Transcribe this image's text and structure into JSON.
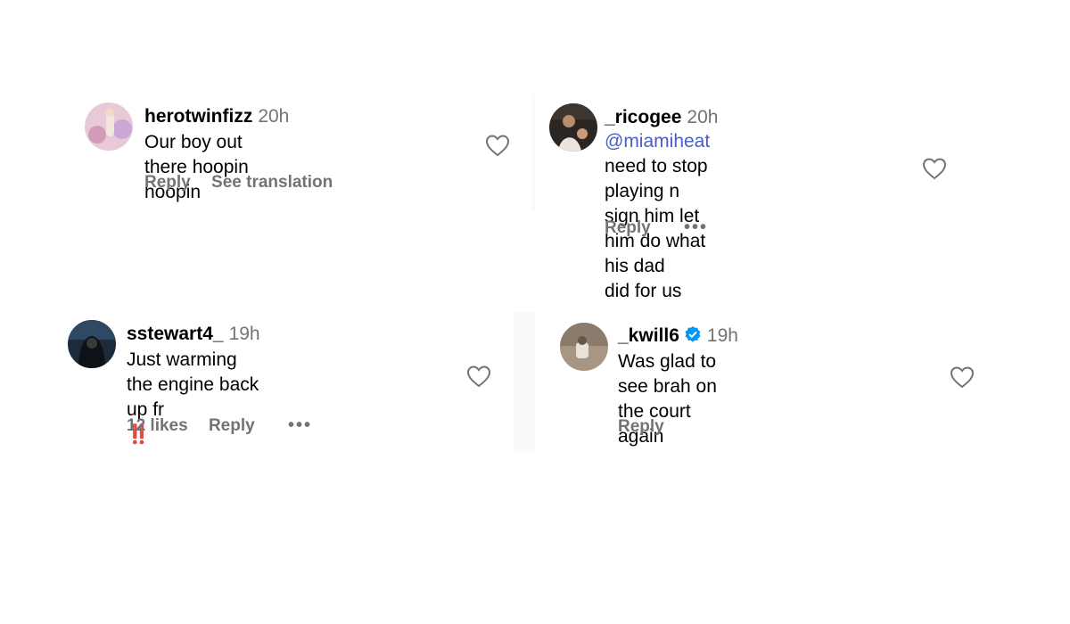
{
  "comments": [
    {
      "username": "herotwinfizz",
      "time": "20h",
      "text": "Our boy out there hoopin hoopin",
      "reply_label": "Reply",
      "translation_label": "See translation"
    },
    {
      "username": "_ricogee",
      "time": "20h",
      "mention": "@miamiheat",
      "text_line1": " need to stop playing n",
      "text_line2": "sign him let him do what his dad",
      "text_line3": "did for us",
      "reply_label": "Reply",
      "more_label": "•••"
    },
    {
      "username": "sstewart4_",
      "time": "19h",
      "text": "Just warming the engine back up fr",
      "emoji": "‼️",
      "likes_label": "12 likes",
      "reply_label": "Reply",
      "more_label": "•••"
    },
    {
      "username": "_kwill6",
      "time": "19h",
      "text_line1": "Was glad to see brah on the court",
      "text_line2": "again",
      "reply_label": "Reply",
      "verified_icon": "verified-badge-icon"
    }
  ],
  "colors": {
    "secondary_text": "#737373",
    "mention": "#4a5fc1",
    "verified": "#0095f6"
  }
}
